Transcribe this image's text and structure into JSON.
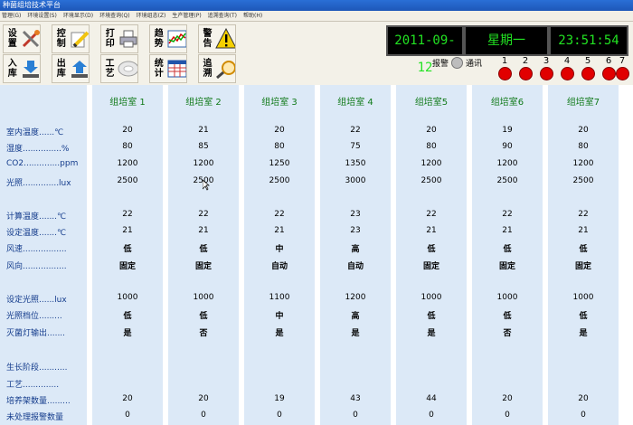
{
  "app": {
    "title": "种菌组培技术平台"
  },
  "menu": [
    "管理(G)",
    "环境设置(S)",
    "环境显示(D)",
    "环境查询(Q)",
    "环境组态(Z)",
    "生产管理(P)",
    "追溯查询(T)",
    "帮助(H)"
  ],
  "toolbar": {
    "buttons": [
      {
        "label": "设置",
        "icon": "settings-tools-icon"
      },
      {
        "label": "控制",
        "icon": "control-pencil-icon"
      },
      {
        "label": "打印",
        "icon": "printer-icon"
      },
      {
        "label": "趋势",
        "icon": "trend-chart-icon"
      },
      {
        "label": "警告",
        "icon": "warning-icon"
      },
      {
        "label": "入库",
        "icon": "stock-in-icon"
      },
      {
        "label": "出库",
        "icon": "stock-out-icon"
      },
      {
        "label": "工艺",
        "icon": "process-disc-icon"
      },
      {
        "label": "统计",
        "icon": "statistics-table-icon"
      },
      {
        "label": "追溯",
        "icon": "trace-magnifier-icon"
      }
    ]
  },
  "clock": {
    "date": "2011-09-12",
    "weekday": "星期一",
    "time": "23:51:54"
  },
  "status": {
    "alarm_label": "报警",
    "comm_label": "通讯"
  },
  "channels": [
    "1",
    "2",
    "3",
    "4",
    "5",
    "6",
    "7"
  ],
  "row_labels": {
    "temp": "室内温度......℃",
    "humidity": "湿度...............%",
    "co2": "CO2..............ppm",
    "light": "光照..............lux",
    "calc_temp": "计算温度.......℃",
    "set_temp": "设定温度.......℃",
    "wind_speed": "风速.................",
    "wind_dir": "风向.................",
    "set_light": "设定光照......lux",
    "light_level": "光照档位.........",
    "uv_output": "灭菌灯输出.......",
    "growth_stage": "生长阶段...........",
    "process": "工艺..............",
    "rack_count": "培养架数量.........",
    "pending_alarms": "未处理报警数量"
  },
  "rooms": [
    {
      "name": "组培室 1",
      "temp": "20",
      "humidity": "80",
      "co2": "1200",
      "light": "2500",
      "calc_temp": "22",
      "set_temp": "21",
      "wind_speed": "低",
      "wind_dir": "固定",
      "set_light": "1000",
      "light_level": "低",
      "uv_output": "是",
      "rack_count": "20",
      "pending_alarms": "0"
    },
    {
      "name": "组培室 2",
      "temp": "21",
      "humidity": "85",
      "co2": "1200",
      "light": "2500",
      "calc_temp": "22",
      "set_temp": "21",
      "wind_speed": "低",
      "wind_dir": "固定",
      "set_light": "1000",
      "light_level": "低",
      "uv_output": "否",
      "rack_count": "20",
      "pending_alarms": "0"
    },
    {
      "name": "组培室 3",
      "temp": "20",
      "humidity": "80",
      "co2": "1250",
      "light": "2500",
      "calc_temp": "22",
      "set_temp": "21",
      "wind_speed": "中",
      "wind_dir": "自动",
      "set_light": "1100",
      "light_level": "中",
      "uv_output": "是",
      "rack_count": "19",
      "pending_alarms": "0"
    },
    {
      "name": "组培室 4",
      "temp": "22",
      "humidity": "75",
      "co2": "1350",
      "light": "3000",
      "calc_temp": "23",
      "set_temp": "23",
      "wind_speed": "高",
      "wind_dir": "自动",
      "set_light": "1200",
      "light_level": "高",
      "uv_output": "是",
      "rack_count": "43",
      "pending_alarms": "0"
    },
    {
      "name": "组培室5",
      "temp": "20",
      "humidity": "80",
      "co2": "1200",
      "light": "2500",
      "calc_temp": "22",
      "set_temp": "21",
      "wind_speed": "低",
      "wind_dir": "固定",
      "set_light": "1000",
      "light_level": "低",
      "uv_output": "是",
      "rack_count": "44",
      "pending_alarms": "0"
    },
    {
      "name": "组培室6",
      "temp": "19",
      "humidity": "90",
      "co2": "1200",
      "light": "2500",
      "calc_temp": "22",
      "set_temp": "21",
      "wind_speed": "低",
      "wind_dir": "固定",
      "set_light": "1000",
      "light_level": "低",
      "uv_output": "否",
      "rack_count": "20",
      "pending_alarms": "0"
    },
    {
      "name": "组培室7",
      "temp": "20",
      "humidity": "80",
      "co2": "1200",
      "light": "2500",
      "calc_temp": "22",
      "set_temp": "21",
      "wind_speed": "低",
      "wind_dir": "固定",
      "set_light": "1000",
      "light_level": "低",
      "uv_output": "是",
      "rack_count": "20",
      "pending_alarms": "0"
    }
  ]
}
